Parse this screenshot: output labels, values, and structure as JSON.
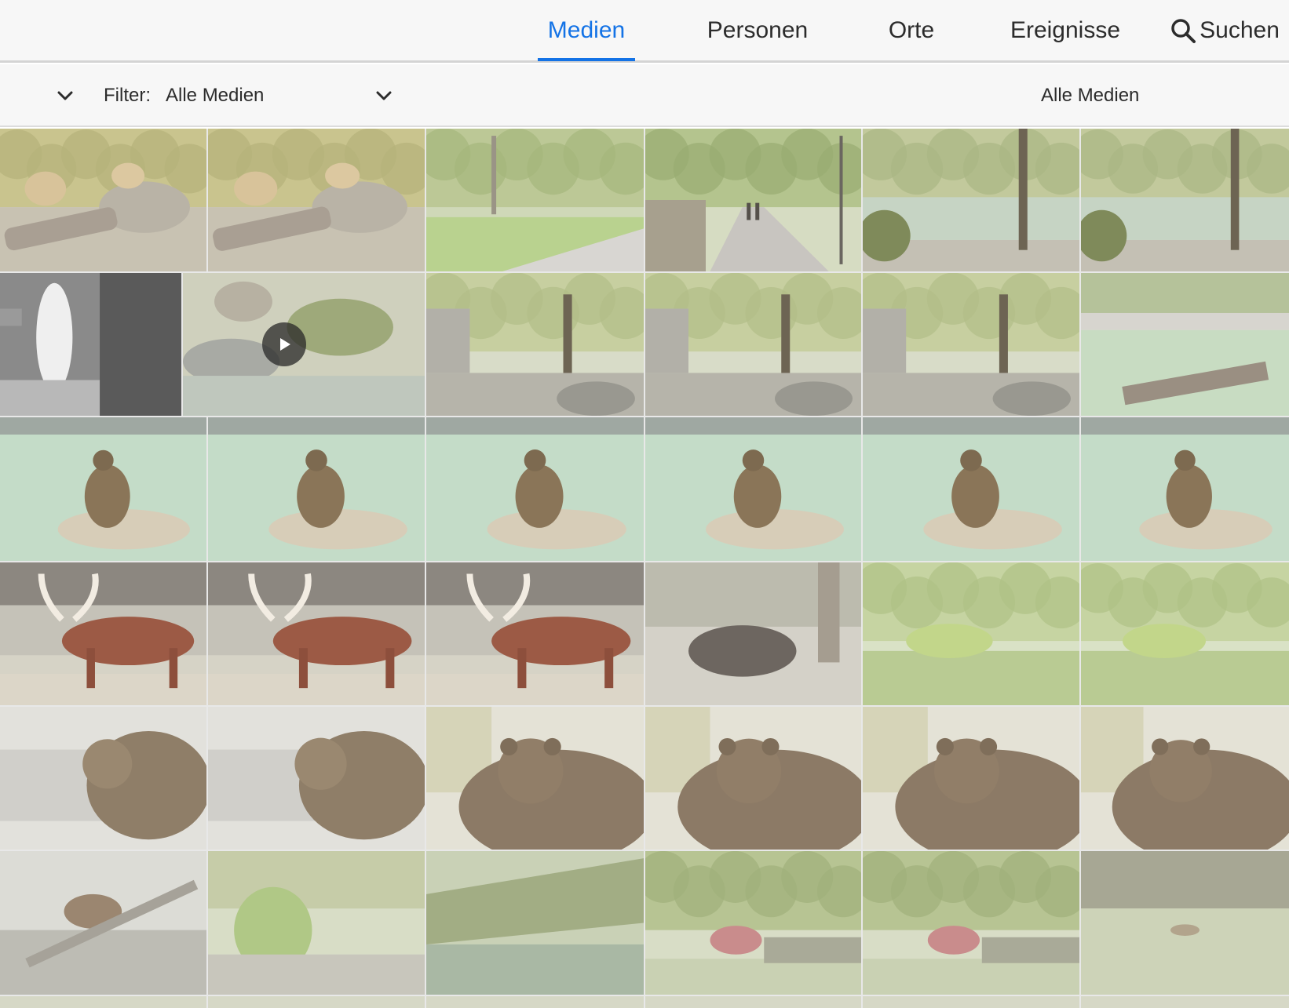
{
  "nav": {
    "tabs": [
      {
        "label": "Medien",
        "active": true
      },
      {
        "label": "Personen",
        "active": false
      },
      {
        "label": "Orte",
        "active": false
      },
      {
        "label": "Ereignisse",
        "active": false
      },
      {
        "label": "Suchen",
        "active": false
      }
    ],
    "accent_color": "#1473e6"
  },
  "filter_bar": {
    "label": "Filter:",
    "value": "Alle Medien",
    "right_label": "Alle Medien"
  },
  "media_grid": {
    "rows": [
      [
        "lions",
        "lions",
        "park-path",
        "alley-walkers",
        "pond-trees",
        "pond-trees"
      ],
      [
        "fountain-bw",
        "pond-video",
        "rocky-enclosure",
        "rocky-enclosure",
        "rocky-enclosure",
        "pool-enclosure"
      ],
      [
        "sea-lion",
        "sea-lion",
        "sea-lion",
        "sea-lion",
        "sea-lion",
        "sea-lion"
      ],
      [
        "watusi-cattle",
        "watusi-cattle",
        "watusi-cattle",
        "bison",
        "park-meadow",
        "park-meadow"
      ],
      [
        "bear-logs",
        "bear-logs",
        "bear-portrait",
        "bear-portrait",
        "bear-portrait",
        "bear-portrait"
      ],
      [
        "bear-resting",
        "stream-grass",
        "stream-water",
        "park-bushes",
        "park-bushes",
        "lynx-enclosure"
      ],
      [
        "partial",
        "partial",
        "partial",
        "partial",
        "partial",
        "partial"
      ]
    ],
    "video_items": [
      "pond-video"
    ],
    "icons": {
      "video": "play-icon",
      "search": "search-icon",
      "chevron": "chevron-down-icon"
    }
  }
}
